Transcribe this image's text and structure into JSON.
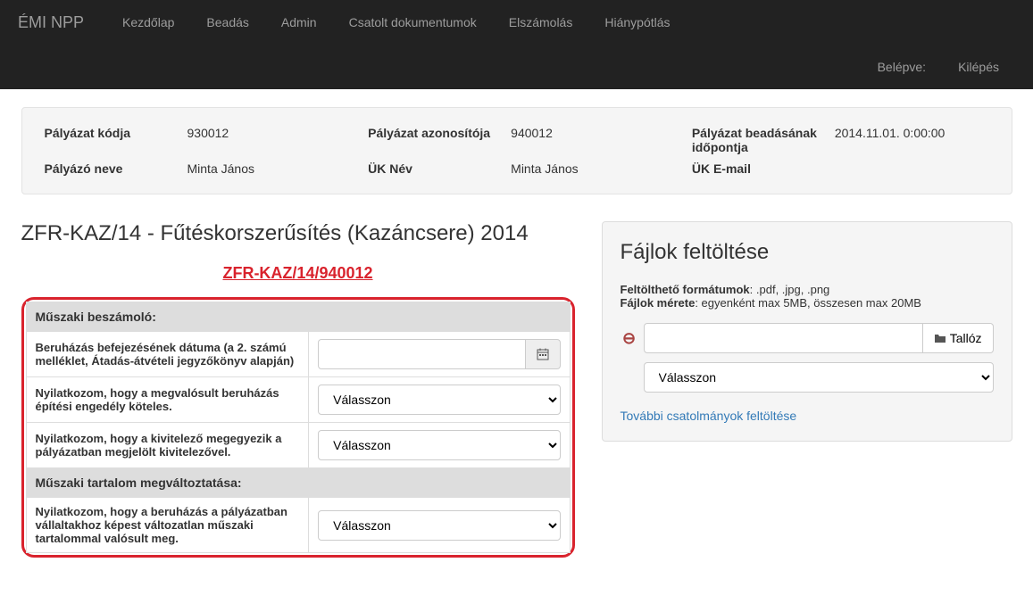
{
  "nav": {
    "brand": "ÉMI NPP",
    "items": [
      "Kezdőlap",
      "Beadás",
      "Admin",
      "Csatolt dokumentumok",
      "Elszámolás",
      "Hiánypótlás"
    ],
    "logged_in_label": "Belépve:",
    "logout": "Kilépés"
  },
  "info": {
    "kod_label": "Pályázat kódja",
    "kod_value": "930012",
    "azon_label": "Pályázat azonosítója",
    "azon_value": "940012",
    "beadas_label": "Pályázat beadásának időpontja",
    "beadas_value": "2014.11.01. 0:00:00",
    "nev_label": "Pályázó neve",
    "nev_value": "Minta János",
    "uknev_label": "ÜK Név",
    "uknev_value": "Minta János",
    "ukemail_label": "ÜK E-mail",
    "ukemail_value": ""
  },
  "main": {
    "title": "ZFR-KAZ/14 - Fűtéskorszerűsítés (Kazáncsere) 2014",
    "project_link": "ZFR-KAZ/14/940012",
    "section1": "Műszaki beszámoló:",
    "row1_label": "Beruházás befejezésének dátuma (a 2. számú melléklet, Átadás-átvételi jegyzőkönyv alapján)",
    "row1_value": "",
    "row2_label": "Nyilatkozom, hogy a megvalósult beruházás építési engedély köteles.",
    "row3_label": "Nyilatkozom, hogy a kivitelező megegyezik a pályázatban megjelölt kivitelezővel.",
    "section2": "Műszaki tartalom megváltoztatása:",
    "row4_label": "Nyilatkozom, hogy a beruházás a pályázatban vállaltakhoz képest változatlan műszaki tartalommal valósult meg.",
    "select_placeholder": "Válasszon"
  },
  "upload": {
    "title": "Fájlok feltöltése",
    "formats_label": "Feltölthető formátumok",
    "formats_value": ": .pdf, .jpg, .png",
    "size_label": "Fájlok mérete",
    "size_value": ": egyenként max 5MB, összesen max 20MB",
    "browse": "Tallóz",
    "select_placeholder": "Válasszon",
    "more_link": "További csatolmányok feltöltése"
  }
}
